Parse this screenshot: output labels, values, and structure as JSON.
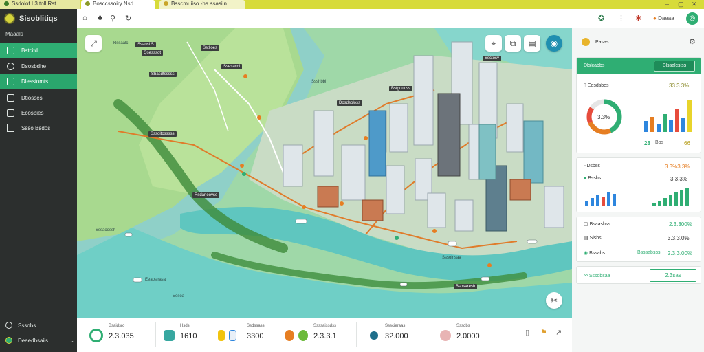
{
  "tabs": [
    {
      "label": "Ssdolof I.3 toll Rst"
    },
    {
      "label": "Bosccssoiry Nsd"
    },
    {
      "label": "Bsscmuiiso -ha ssasiin"
    }
  ],
  "sidebar": {
    "brand": "Sisoblitiqs",
    "menu_title": "Maaals",
    "items": [
      {
        "label": "Bstcitd",
        "icon": "chart-icon"
      },
      {
        "label": "Dsosbdhe",
        "icon": "layers-icon"
      },
      {
        "label": "Dlessiomts",
        "icon": "table-icon"
      },
      {
        "label": "Dtiosses",
        "icon": "grid-icon"
      },
      {
        "label": "Ecosbies",
        "icon": "chat-icon"
      },
      {
        "label": "Ssso Bsdos",
        "icon": "alert-icon"
      }
    ],
    "bottom": [
      {
        "label": "Sssobs",
        "icon": "settings-icon"
      },
      {
        "label": "Deaedbsaiis",
        "icon": "user-icon"
      }
    ]
  },
  "topbar": {
    "right_label": "Daeaa"
  },
  "map": {
    "labels": [
      "Rssaalc",
      "Ssaosl S",
      "Qsesssot",
      "Sstlioes",
      "Ssesaccl",
      "Sbasdtsssss",
      "Ssshbbl",
      "Ssctosv",
      "Bstgouuss",
      "Dosdsoloss",
      "Sssoitosssss",
      "Rsdaneovse",
      "Sssaoossh",
      "Eeaosirasa",
      "Eesoa",
      "Bsosaresh",
      "Sssoinsaa"
    ]
  },
  "stats": [
    {
      "label": "Bsaidsro",
      "value": "2.3.035",
      "color": "#2fae73"
    },
    {
      "label": "Hsds",
      "value": "1610",
      "color": "#37a7a0"
    },
    {
      "label": "Ssdssass",
      "value": "3300",
      "color": "#f1c40f"
    },
    {
      "label": "Ssssaissdss",
      "value": "2.3.3.1",
      "color": "#e67e22"
    },
    {
      "label": "Ssscieraas",
      "value": "32.000",
      "color": "#1f6f8b"
    },
    {
      "label": "Sssdbs",
      "value": "2.0000",
      "color": "#d98a8a"
    }
  ],
  "panel": {
    "header": "Pasas",
    "tab_title": "Dlslcabbs",
    "tab_button": "Blssalcslss",
    "kpi_label": "Eesdsbes",
    "kpi_value": "33.3.3%",
    "donut_value": "3.3%",
    "kpi_left": "28",
    "kpi_mid": "Bbs",
    "kpi_right": "66",
    "row1_label": "Dsbss",
    "row1_value": "3.3%3.3%",
    "row2_label": "Bssbs",
    "row2_value": "3.3.3%",
    "row3_label": "Bsaasbss",
    "row3_value": "2.3.300%",
    "row4_label": "Slsbs",
    "row4_value": "3.3.3.0%",
    "row5_label": "Bssabs",
    "row5_mid": "Bsssabsss",
    "row5_value": "2.3.3.00%",
    "footer_label": "Sssobsaa",
    "footer_button": "2.3sas",
    "colors": {
      "green": "#2fae73",
      "orange": "#e67e22",
      "blue": "#2e86de",
      "yellow": "#e8d42b"
    }
  }
}
